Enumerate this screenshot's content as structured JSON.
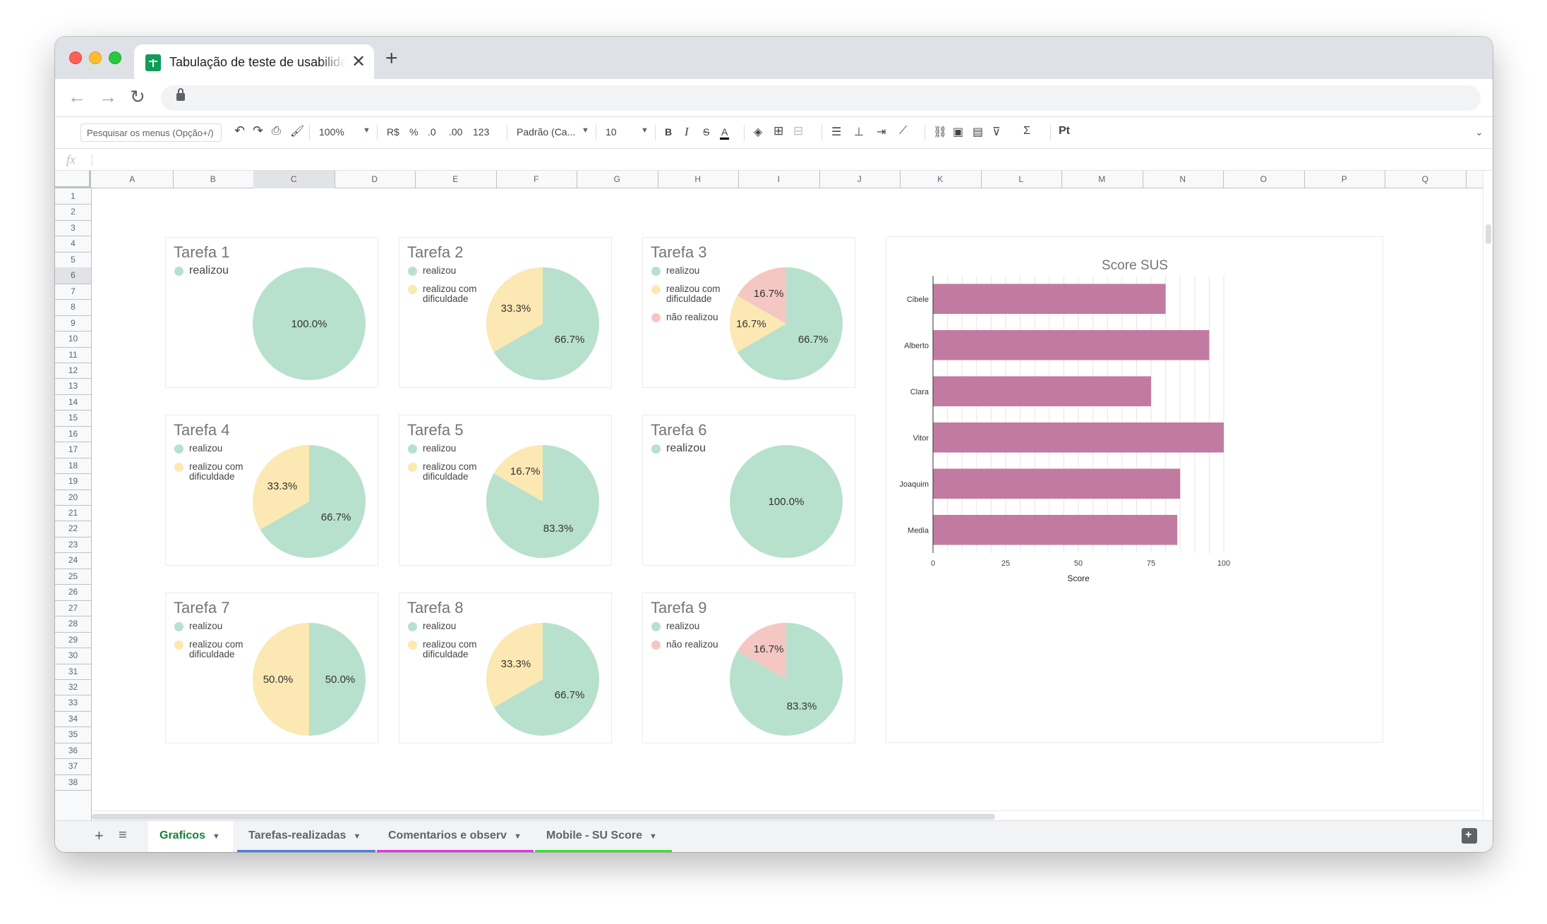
{
  "browser": {
    "tab_title": "Tabulação de teste de usabilidade",
    "tab_close": "✕",
    "new_tab": "+",
    "back": "←",
    "forward": "→",
    "reload": "↻"
  },
  "toolbar": {
    "menu_search_placeholder": "Pesquisar os menus (Opção+/)",
    "zoom": "100%",
    "currency": "R$",
    "percent": "%",
    "decrease_decimals": ".0",
    "increase_decimals": ".00",
    "more_formats": "123",
    "font": "Padrão (Ca...",
    "font_size": "10",
    "bold": "B",
    "italic": "I",
    "strike": "S",
    "text_color": "A"
  },
  "formula_bar": {
    "fx": "fx"
  },
  "columns": [
    "A",
    "B",
    "C",
    "D",
    "E",
    "F",
    "G",
    "H",
    "I",
    "J",
    "K",
    "L",
    "M",
    "N",
    "O",
    "P",
    "Q"
  ],
  "rows": [
    "1",
    "2",
    "3",
    "4",
    "5",
    "6",
    "7",
    "8",
    "9",
    "10",
    "11",
    "12",
    "13",
    "14",
    "15",
    "16",
    "17",
    "18",
    "19",
    "20",
    "21",
    "22",
    "23",
    "24",
    "25",
    "26",
    "27",
    "28",
    "29",
    "30",
    "31",
    "32",
    "33",
    "34",
    "35",
    "36",
    "37",
    "38"
  ],
  "colors": {
    "realizou": "#b7e1cd",
    "dificuldade": "#fce8b2",
    "nao_realizou": "#f4c7c3",
    "bar": "#c27ba0",
    "active_tab": "#188038"
  },
  "pie_charts": [
    {
      "title": "Tarefa 1",
      "legend": [
        "realizou"
      ],
      "slices": [
        {
          "label": "100.0%",
          "value": 100,
          "color": "realizou"
        }
      ]
    },
    {
      "title": "Tarefa 2",
      "legend": [
        "realizou",
        "realizou com dificuldade"
      ],
      "slices": [
        {
          "label": "66.7%",
          "value": 66.7,
          "color": "realizou"
        },
        {
          "label": "33.3%",
          "value": 33.3,
          "color": "dificuldade"
        }
      ]
    },
    {
      "title": "Tarefa 3",
      "legend": [
        "realizou",
        "realizou com dificuldade",
        "não realizou"
      ],
      "slices": [
        {
          "label": "66.7%",
          "value": 66.7,
          "color": "realizou"
        },
        {
          "label": "16.7%",
          "value": 16.7,
          "color": "dificuldade"
        },
        {
          "label": "16.7%",
          "value": 16.7,
          "color": "nao_realizou"
        }
      ]
    },
    {
      "title": "Tarefa 4",
      "legend": [
        "realizou",
        "realizou com dificuldade"
      ],
      "slices": [
        {
          "label": "66.7%",
          "value": 66.7,
          "color": "realizou"
        },
        {
          "label": "33.3%",
          "value": 33.3,
          "color": "dificuldade"
        }
      ]
    },
    {
      "title": "Tarefa 5",
      "legend": [
        "realizou",
        "realizou com dificuldade"
      ],
      "slices": [
        {
          "label": "83.3%",
          "value": 83.3,
          "color": "realizou"
        },
        {
          "label": "16.7%",
          "value": 16.7,
          "color": "dificuldade"
        }
      ]
    },
    {
      "title": "Tarefa 6",
      "legend": [
        "realizou"
      ],
      "slices": [
        {
          "label": "100.0%",
          "value": 100,
          "color": "realizou"
        }
      ]
    },
    {
      "title": "Tarefa 7",
      "legend": [
        "realizou",
        "realizou com dificuldade"
      ],
      "slices": [
        {
          "label": "50.0%",
          "value": 50,
          "color": "realizou"
        },
        {
          "label": "50.0%",
          "value": 50,
          "color": "dificuldade"
        }
      ]
    },
    {
      "title": "Tarefa 8",
      "legend": [
        "realizou",
        "realizou com dificuldade"
      ],
      "slices": [
        {
          "label": "66.7%",
          "value": 66.7,
          "color": "realizou"
        },
        {
          "label": "33.3%",
          "value": 33.3,
          "color": "dificuldade"
        }
      ]
    },
    {
      "title": "Tarefa 9",
      "legend": [
        "realizou",
        "não realizou"
      ],
      "slices": [
        {
          "label": "83.3%",
          "value": 83.3,
          "color": "realizou"
        },
        {
          "label": "16.7%",
          "value": 16.7,
          "color": "nao_realizou"
        }
      ]
    }
  ],
  "chart_data": {
    "type": "bar",
    "orientation": "horizontal",
    "title": "Score SUS",
    "xlabel": "Score",
    "ylabel": "",
    "categories": [
      "Cibele",
      "Alberto",
      "Clara",
      "Vitor",
      "Joaquim",
      "Media"
    ],
    "values": [
      80,
      95,
      75,
      100,
      85,
      84
    ],
    "xlim": [
      0,
      100
    ],
    "xticks": [
      0,
      25,
      50,
      75,
      100
    ],
    "grid": true,
    "legend": "none"
  },
  "sheet_tabs": [
    {
      "label": "Graficos",
      "active": true,
      "underline": ""
    },
    {
      "label": "Tarefas-realizadas",
      "active": false,
      "underline": "#4a7de0"
    },
    {
      "label": "Comentarios e observ",
      "active": false,
      "underline": "#e232e8"
    },
    {
      "label": "Mobile - SU Score",
      "active": false,
      "underline": "#2ee82e"
    }
  ],
  "sheet_tab_controls": {
    "add": "+",
    "list": "≡",
    "caret": "▼"
  }
}
